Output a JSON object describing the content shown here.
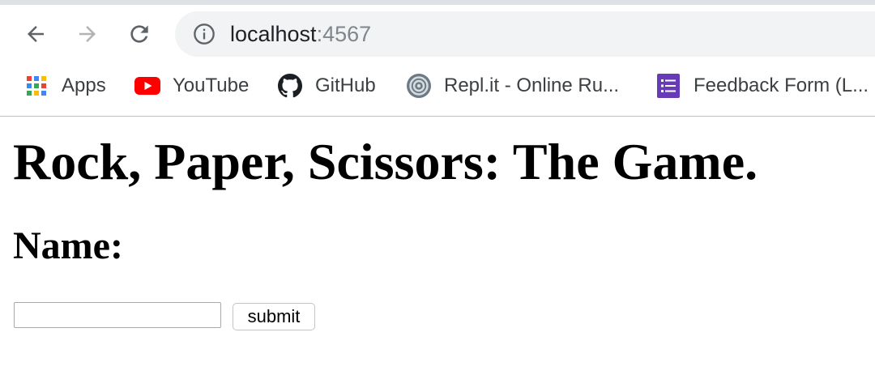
{
  "browser": {
    "url_host": "localhost",
    "url_port": ":4567",
    "bookmarks": [
      {
        "label": "Apps",
        "icon": "apps-grid-icon"
      },
      {
        "label": "YouTube",
        "icon": "youtube-icon"
      },
      {
        "label": "GitHub",
        "icon": "github-icon"
      },
      {
        "label": "Repl.it - Online Ru...",
        "icon": "replit-icon"
      },
      {
        "label": "Feedback Form (L...",
        "icon": "google-forms-icon"
      }
    ]
  },
  "page": {
    "heading": "Rock, Paper, Scissors: The Game.",
    "name_label": "Name:",
    "name_input_value": "",
    "submit_label": "submit"
  },
  "colors": {
    "youtube_red": "#ff0000",
    "forms_purple": "#673ab7",
    "omnibox_bg": "#f1f3f4"
  }
}
